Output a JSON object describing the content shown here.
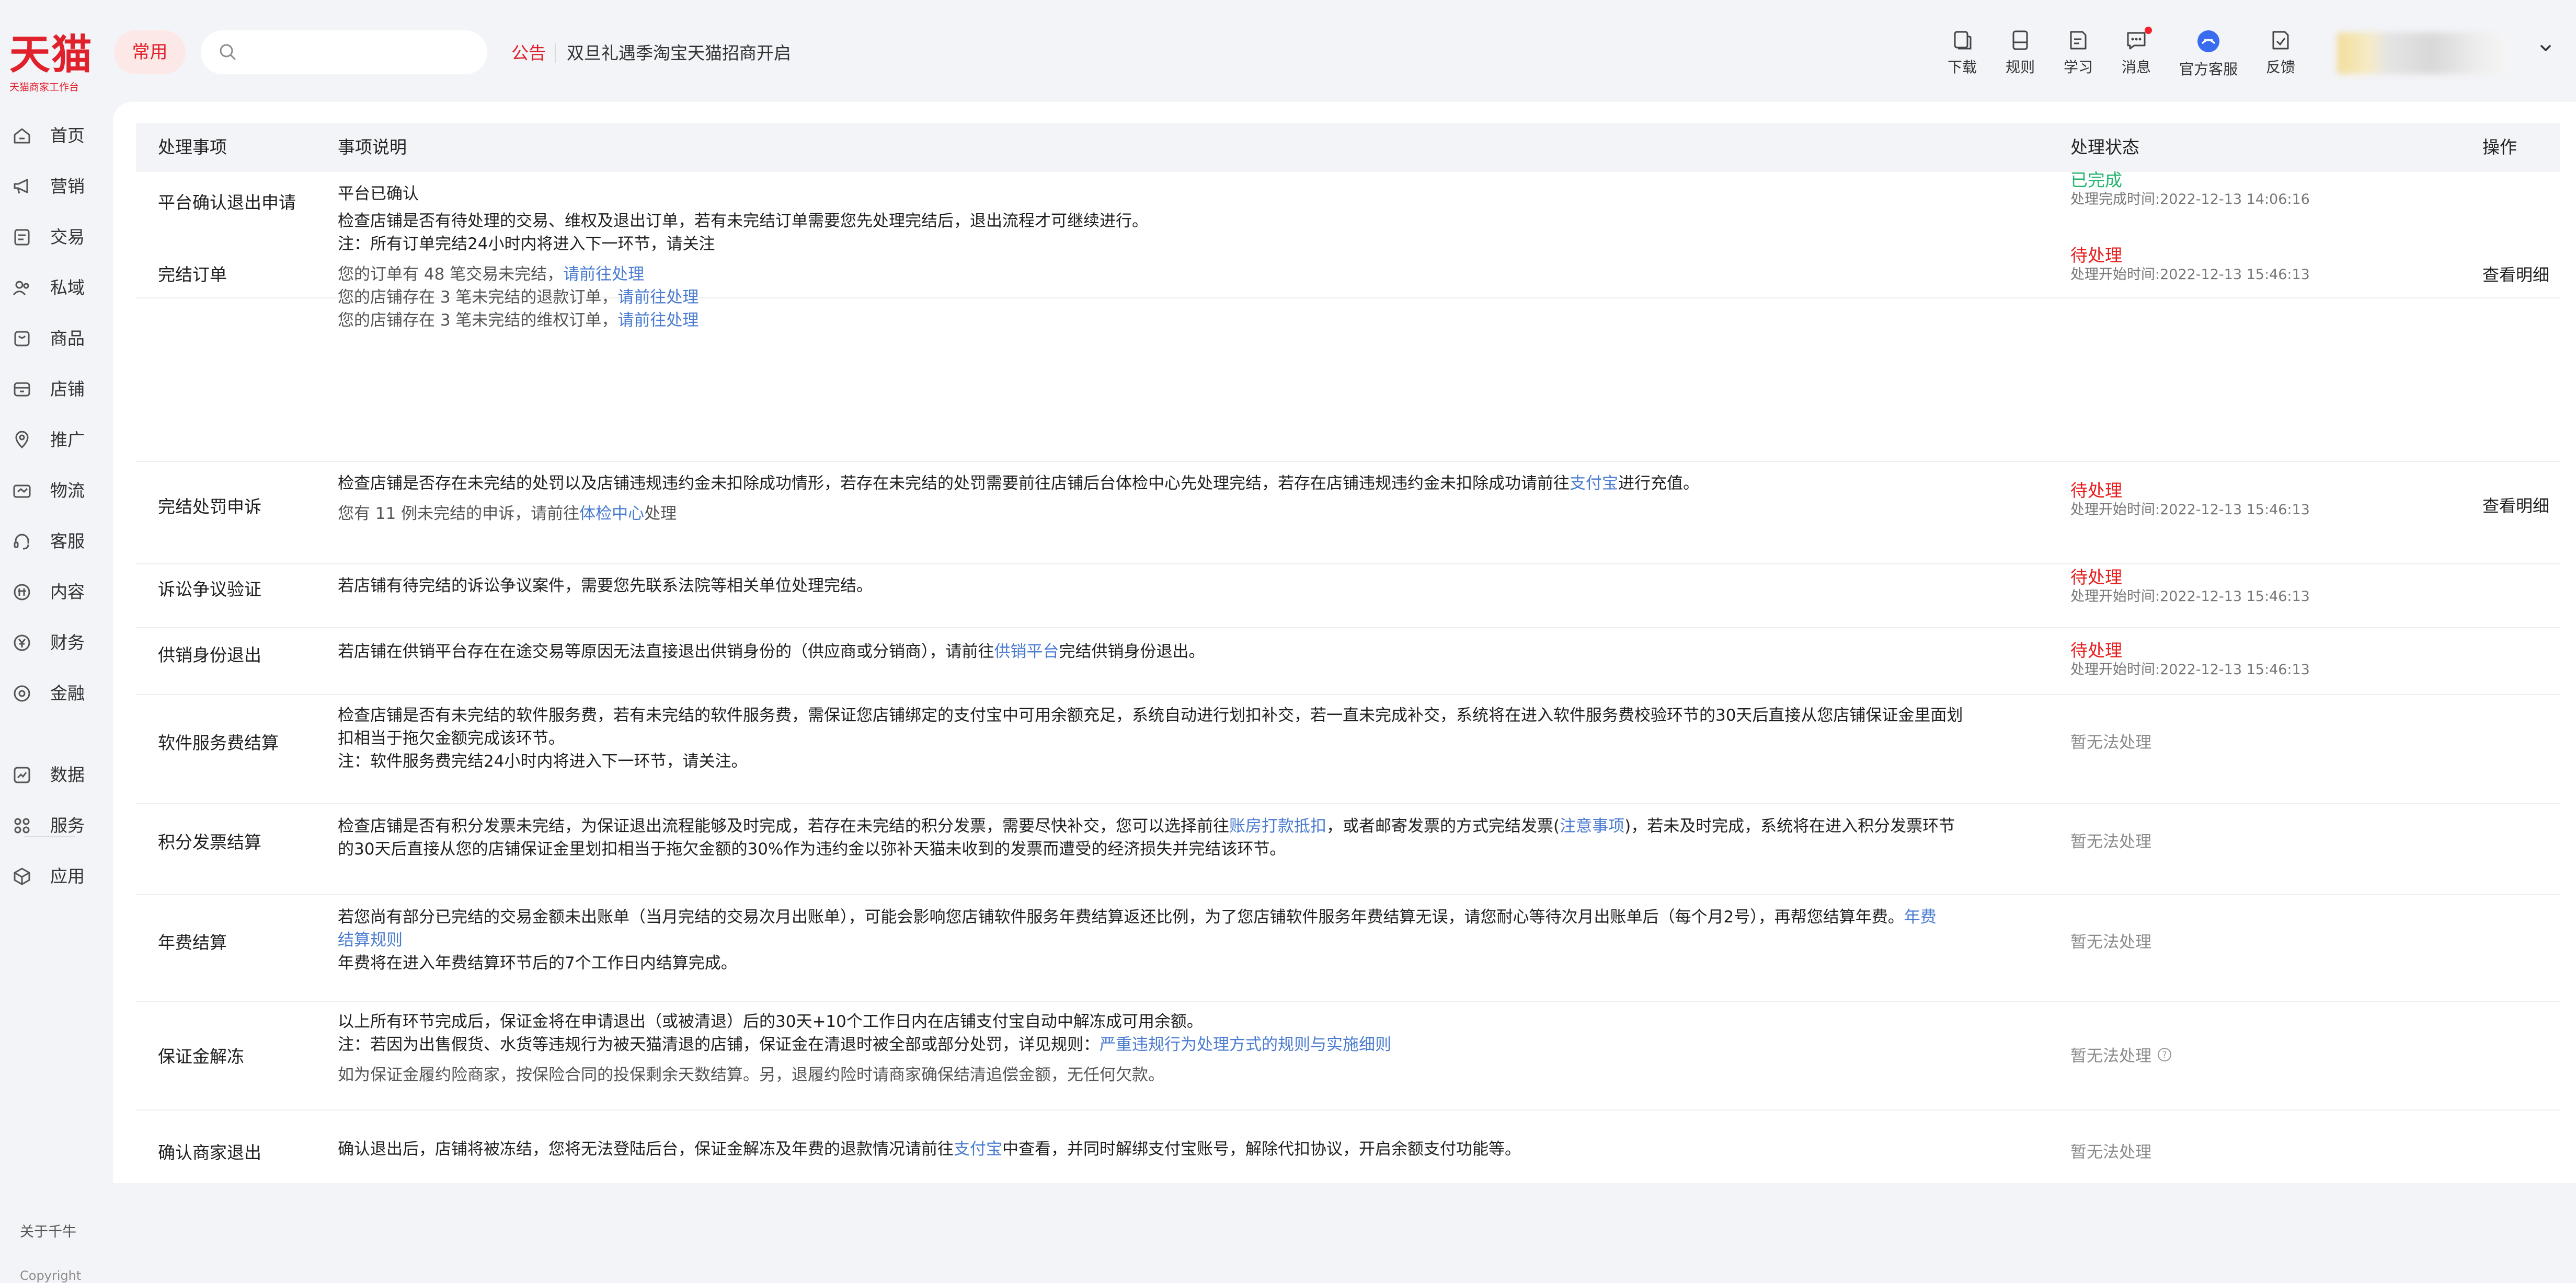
{
  "brand": {
    "logo_text": "天猫",
    "logo_sub": "天猫商家工作台"
  },
  "header": {
    "frequent_label": "常用",
    "search_placeholder": "",
    "notice_label": "公告",
    "notice_text": "双旦礼遇季淘宝天猫招商开启",
    "tools": [
      {
        "label": "下载",
        "icon": "download-icon"
      },
      {
        "label": "规则",
        "icon": "rules-icon"
      },
      {
        "label": "学习",
        "icon": "study-icon"
      },
      {
        "label": "消息",
        "icon": "message-icon"
      },
      {
        "label": "官方客服",
        "icon": "customer-service-icon"
      },
      {
        "label": "反馈",
        "icon": "feedback-icon"
      }
    ]
  },
  "sidebar": {
    "items": [
      {
        "label": "首页",
        "icon": "home-icon"
      },
      {
        "label": "营销",
        "icon": "megaphone-icon"
      },
      {
        "label": "交易",
        "icon": "trade-icon"
      },
      {
        "label": "私域",
        "icon": "private-domain-icon"
      },
      {
        "label": "商品",
        "icon": "goods-icon"
      },
      {
        "label": "店铺",
        "icon": "shop-icon"
      },
      {
        "label": "推广",
        "icon": "promotion-icon"
      },
      {
        "label": "物流",
        "icon": "logistics-icon"
      },
      {
        "label": "客服",
        "icon": "headset-icon"
      },
      {
        "label": "内容",
        "icon": "content-icon"
      },
      {
        "label": "财务",
        "icon": "finance-icon"
      },
      {
        "label": "金融",
        "icon": "bank-icon"
      },
      {
        "label": "数据",
        "icon": "data-icon"
      },
      {
        "label": "服务",
        "icon": "service-icon"
      },
      {
        "label": "应用",
        "icon": "app-icon"
      }
    ],
    "about": "关于千牛",
    "copyright": "Copyright"
  },
  "table": {
    "headers": {
      "item": "处理事项",
      "desc": "事项说明",
      "status": "处理状态",
      "op": "操作"
    },
    "colors": {
      "done": "#27b46e",
      "pending": "#e61e1e",
      "link": "#4a7bd0"
    },
    "rows": [
      {
        "name": "平台确认退出申请",
        "desc": [
          {
            "text": "平台已确认"
          }
        ],
        "status": {
          "kind": "done",
          "label": "已完成",
          "time": "处理完成时间:2022-12-13 14:06:16"
        },
        "op": ""
      },
      {
        "name": "完结订单",
        "desc": [
          {
            "text": "检查店铺是否有待处理的交易、维权及退出订单，若有未完结订单需要您先处理完结后，退出流程才可继续进行。"
          },
          {
            "text": "注：所有订单完结24小时内将进入下一环节，请关注"
          },
          {
            "gap": true
          },
          {
            "text": "您的订单有 48 笔交易未完结，",
            "link": "请前往处理",
            "sub": true
          },
          {
            "text": "您的店铺存在 3 笔未完结的退款订单，",
            "link": "请前往处理",
            "sub": true
          },
          {
            "text": "您的店铺存在 3 笔未完结的维权订单，",
            "link": "请前往处理",
            "sub": true
          }
        ],
        "status": {
          "kind": "pending",
          "label": "待处理",
          "time": "处理开始时间:2022-12-13 15:46:13"
        },
        "op": "查看明细"
      },
      {
        "name": "完结处罚申诉",
        "desc": [
          {
            "text": "检查店铺是否存在未完结的处罚以及店铺违规违约金未扣除成功情形，若存在未完结的处罚需要前往店铺后台体检中心先处理完结，若存在店铺违规违约金未扣除成功请前往",
            "link": "支付宝",
            "after": "进行充值。"
          },
          {
            "gap": true
          },
          {
            "text": "您有 11 例未完结的申诉，请前往",
            "link": "体检中心",
            "after": "处理",
            "sub": true
          }
        ],
        "status": {
          "kind": "pending",
          "label": "待处理",
          "time": "处理开始时间:2022-12-13 15:46:13"
        },
        "op": "查看明细"
      },
      {
        "name": "诉讼争议验证",
        "desc": [
          {
            "text": "若店铺有待完结的诉讼争议案件，需要您先联系法院等相关单位处理完结。"
          }
        ],
        "status": {
          "kind": "pending",
          "label": "待处理",
          "time": "处理开始时间:2022-12-13 15:46:13"
        },
        "op": ""
      },
      {
        "name": "供销身份退出",
        "desc": [
          {
            "text": "若店铺在供销平台存在在途交易等原因无法直接退出供销身份的（供应商或分销商），请前往",
            "link": "供销平台",
            "after": "完结供销身份退出。"
          }
        ],
        "status": {
          "kind": "pending",
          "label": "待处理",
          "time": "处理开始时间:2022-12-13 15:46:13"
        },
        "op": ""
      },
      {
        "name": "软件服务费结算",
        "desc": [
          {
            "text": "检查店铺是否有未完结的软件服务费，若有未完结的软件服务费，需保证您店铺绑定的支付宝中可用余额充足，系统自动进行划扣补交，若一直未完成补交，系统将在进入软件服务费校验环节的30天后直接从您店铺保证金里面划"
          },
          {
            "text": "扣相当于拖欠金额完成该环节。"
          },
          {
            "text": "注：软件服务费完结24小时内将进入下一环节，请关注。"
          }
        ],
        "status": {
          "kind": "none",
          "label": "暂无法处理"
        },
        "op": ""
      },
      {
        "name": "积分发票结算",
        "desc": [
          {
            "text": "检查店铺是否有积分发票未完结，为保证退出流程能够及时完成，若存在未完结的积分发票，需要尽快补交，您可以选择前往",
            "link": "账房打款抵扣",
            "after": "，或者邮寄发票的方式完结发票(",
            "link2": "注意事项",
            "after2": ")，若未及时完成，系统将在进入积分发票环节"
          },
          {
            "text": "的30天后直接从您的店铺保证金里划扣相当于拖欠金额的30%作为违约金以弥补天猫未收到的发票而遭受的经济损失并完结该环节。"
          }
        ],
        "status": {
          "kind": "none",
          "label": "暂无法处理"
        },
        "op": ""
      },
      {
        "name": "年费结算",
        "desc": [
          {
            "text": "若您尚有部分已完结的交易金额未出账单（当月完结的交易次月出账单），可能会影响您店铺软件服务年费结算返还比例，为了您店铺软件服务年费结算无误，请您耐心等待次月出账单后（每个月2号），再帮您结算年费。",
            "link": "年费"
          },
          {
            "text": "",
            "link": "结算规则"
          },
          {
            "text": "年费将在进入年费结算环节后的7个工作日内结算完成。"
          }
        ],
        "status": {
          "kind": "none",
          "label": "暂无法处理"
        },
        "op": ""
      },
      {
        "name": "保证金解冻",
        "desc": [
          {
            "text": "以上所有环节完成后，保证金将在申请退出（或被清退）后的30天+10个工作日内在店铺支付宝自动中解冻成可用余额。"
          },
          {
            "text": "注：若因为出售假货、水货等违规行为被天猫清退的店铺，保证金在清退时被全部或部分处罚，详见规则：",
            "link": "严重违规行为处理方式的规则与实施细则"
          },
          {
            "gap": true
          },
          {
            "text": "如为保证金履约险商家，按保险合同的投保剩余天数结算。另，退履约险时请商家确保结清追偿金额，无任何欠款。",
            "sub": true
          }
        ],
        "status": {
          "kind": "none",
          "label": "暂无法处理",
          "help": true
        },
        "op": ""
      },
      {
        "name": "确认商家退出",
        "desc": [
          {
            "text": "确认退出后，店铺将被冻结，您将无法登陆后台，保证金解冻及年费的退款情况请前往",
            "link": "支付宝",
            "after": "中查看，并同时解绑支付宝账号，解除代扣协议，开启余额支付功能等。"
          }
        ],
        "status": {
          "kind": "none",
          "label": "暂无法处理"
        },
        "op": ""
      }
    ]
  }
}
